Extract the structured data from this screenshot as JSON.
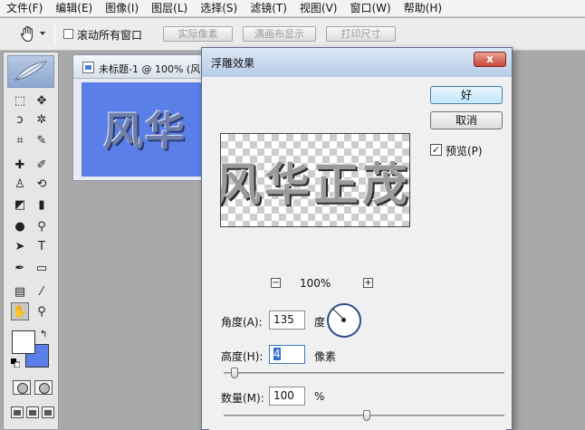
{
  "menu": {
    "items": [
      "文件(F)",
      "编辑(E)",
      "图像(I)",
      "图层(L)",
      "选择(S)",
      "滤镜(T)",
      "视图(V)",
      "窗口(W)",
      "帮助(H)"
    ]
  },
  "options": {
    "scroll_all_windows": "滚动所有窗口",
    "scroll_all_checked": false,
    "actual_pixels": "实际像素",
    "fit_screen": "满画布显示",
    "print_size": "打印尺寸",
    "tool_icon": "hand-icon"
  },
  "document": {
    "title": "未标题-1 @ 100% (风",
    "canvas_text": "风华",
    "canvas_color": "#5b7fe8"
  },
  "toolbox": {
    "background_color": "#5b7fe8",
    "foreground_color": "#ffffff",
    "tools": [
      {
        "name": "marquee-icon",
        "glyph": "⬚"
      },
      {
        "name": "move-icon",
        "glyph": "✥"
      },
      {
        "name": "lasso-icon",
        "glyph": "ↄ"
      },
      {
        "name": "magic-wand-icon",
        "glyph": "✲"
      },
      {
        "name": "crop-icon",
        "glyph": "⌗"
      },
      {
        "name": "slice-icon",
        "glyph": "✎"
      },
      {
        "name": "healing-brush-icon",
        "glyph": "✚"
      },
      {
        "name": "brush-icon",
        "glyph": "✐"
      },
      {
        "name": "stamp-icon",
        "glyph": "♙"
      },
      {
        "name": "history-brush-icon",
        "glyph": "⟲"
      },
      {
        "name": "eraser-icon",
        "glyph": "◩"
      },
      {
        "name": "gradient-icon",
        "glyph": "▮"
      },
      {
        "name": "blur-icon",
        "glyph": "●"
      },
      {
        "name": "dodge-icon",
        "glyph": "⚲"
      },
      {
        "name": "path-select-icon",
        "glyph": "➤"
      },
      {
        "name": "type-icon",
        "glyph": "T"
      },
      {
        "name": "pen-icon",
        "glyph": "✒"
      },
      {
        "name": "shape-icon",
        "glyph": "▭"
      },
      {
        "name": "notes-icon",
        "glyph": "▤"
      },
      {
        "name": "eyedropper-icon",
        "glyph": "⁄"
      },
      {
        "name": "hand-icon",
        "glyph": "✋"
      },
      {
        "name": "zoom-icon",
        "glyph": "⚲"
      }
    ]
  },
  "dialog": {
    "title": "浮雕效果",
    "close_glyph": "x",
    "ok_label": "好",
    "cancel_label": "取消",
    "preview_label": "预览(P)",
    "preview_checked": true,
    "preview_text": "风华正茂",
    "zoom": "100%",
    "zoom_out_glyph": "−",
    "zoom_in_glyph": "+",
    "angle_label": "角度(A):",
    "angle_value": "135",
    "angle_unit": "度",
    "height_label": "高度(H):",
    "height_value": "4",
    "height_unit": "像素",
    "amount_label": "数量(M):",
    "amount_value": "100",
    "amount_unit": "%",
    "height_slider_fraction": 0.04,
    "amount_slider_fraction": 0.51
  }
}
